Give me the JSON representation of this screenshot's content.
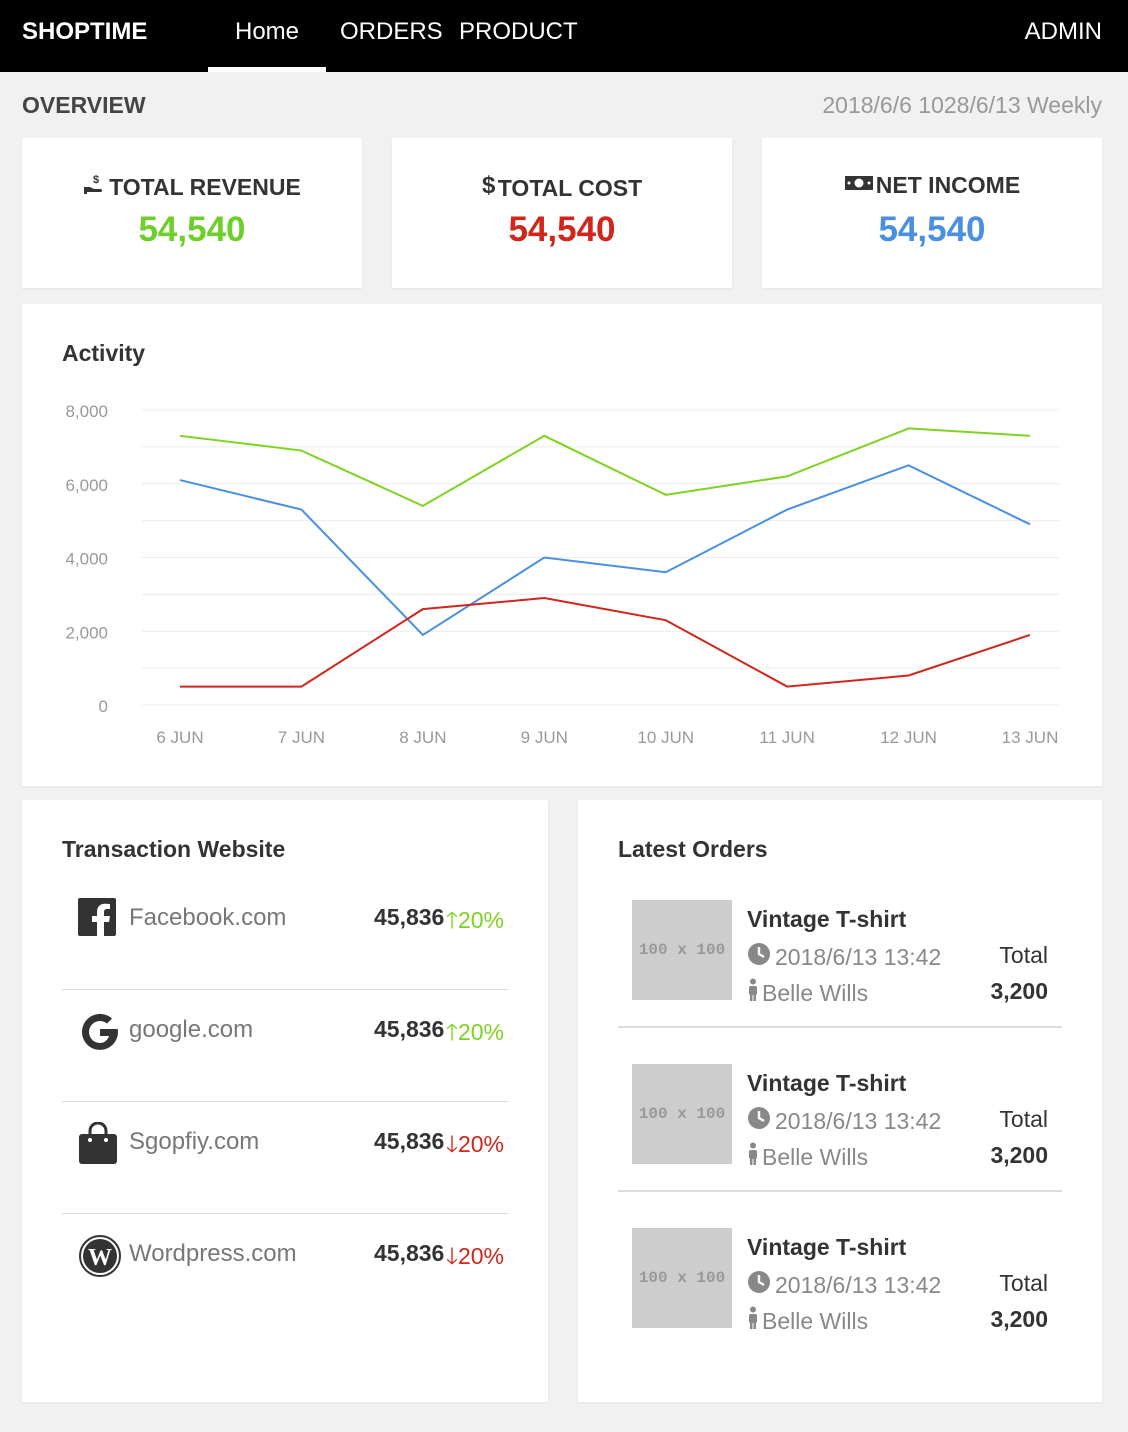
{
  "nav": {
    "brand": "SHOPTIME",
    "links": [
      "Home",
      "ORDERS",
      "PRODUCT"
    ],
    "active": "Home",
    "user": "ADMIN"
  },
  "overview": {
    "title": "OVERVIEW",
    "date_range": "2018/6/6 1028/6/13 Weekly"
  },
  "stats": [
    {
      "label": "TOTAL REVENUE",
      "value": "54,540",
      "icon": "hand-money-icon",
      "color": "#6fcf2a"
    },
    {
      "label": "TOTAL COST",
      "value": "54,540",
      "icon": "dollar-icon",
      "color": "#d0261c"
    },
    {
      "label": "NET INCOME",
      "value": "54,540",
      "icon": "banknote-icon",
      "color": "#4a90e2"
    }
  ],
  "activity": {
    "title": "Activity"
  },
  "chart_data": {
    "type": "line",
    "title": "Activity",
    "categories": [
      "6 JUN",
      "7 JUN",
      "8 JUN",
      "9 JUN",
      "10 JUN",
      "11 JUN",
      "12 JUN",
      "13 JUN"
    ],
    "y_ticks": [
      "0",
      "2,000",
      "4,000",
      "6,000",
      "8,000"
    ],
    "ylim": [
      0,
      8000
    ],
    "grid": true,
    "series": [
      {
        "color": "#7ed321",
        "values": [
          7300,
          6900,
          5400,
          7300,
          5700,
          6200,
          7500,
          7300
        ]
      },
      {
        "color": "#4a90e2",
        "values": [
          6100,
          5300,
          1900,
          4000,
          3600,
          5300,
          6500,
          4900
        ]
      },
      {
        "color": "#d0261c",
        "values": [
          500,
          500,
          2600,
          2900,
          2300,
          500,
          800,
          1900
        ]
      }
    ]
  },
  "transactions": {
    "title": "Transaction Website",
    "rows": [
      {
        "name": "Facebook.com",
        "icon": "facebook-icon",
        "amount": "45,836",
        "direction": "up",
        "percent": "20%"
      },
      {
        "name": "google.com",
        "icon": "google-icon",
        "amount": "45,836",
        "direction": "up",
        "percent": "20%"
      },
      {
        "name": "Sgopfiy.com",
        "icon": "shopping-bag-icon",
        "amount": "45,836",
        "direction": "down",
        "percent": "20%"
      },
      {
        "name": "Wordpress.com",
        "icon": "wordpress-icon",
        "amount": "45,836",
        "direction": "down",
        "percent": "20%"
      }
    ],
    "colors": {
      "up": "#7ed321",
      "down": "#d0261c"
    }
  },
  "orders": {
    "title": "Latest Orders",
    "items": [
      {
        "thumb": "100 x 100",
        "name": "Vintage T-shirt",
        "time": "2018/6/13 13:42",
        "customer": "Belle Wills",
        "total_label": "Total",
        "total": "3,200"
      },
      {
        "thumb": "100 x 100",
        "name": "Vintage T-shirt",
        "time": "2018/6/13 13:42",
        "customer": "Belle Wills",
        "total_label": "Total",
        "total": "3,200"
      },
      {
        "thumb": "100 x 100",
        "name": "Vintage T-shirt",
        "time": "2018/6/13 13:42",
        "customer": "Belle Wills",
        "total_label": "Total",
        "total": "3,200"
      }
    ]
  }
}
